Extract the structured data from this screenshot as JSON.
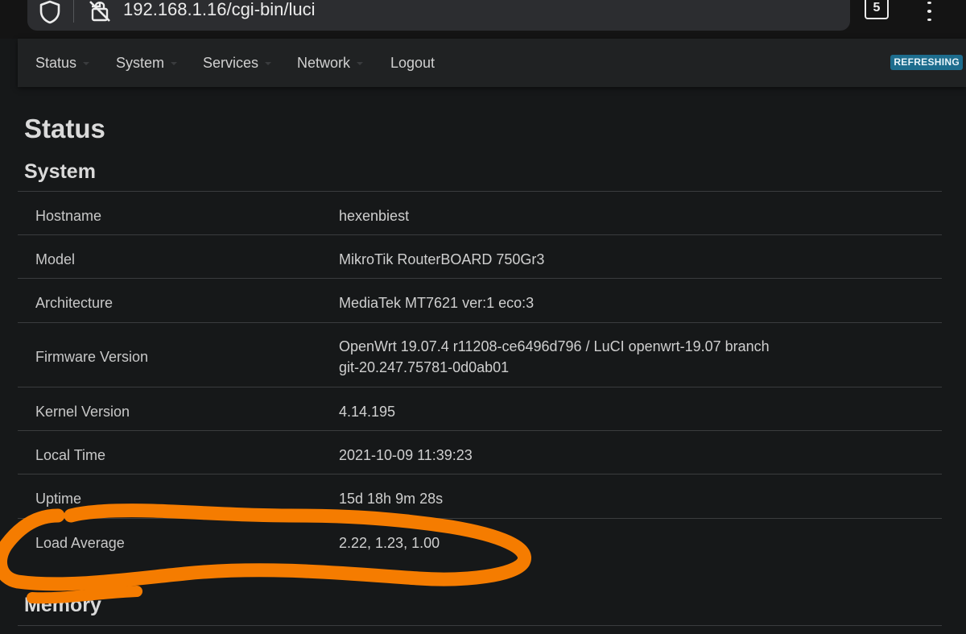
{
  "browser": {
    "url": "192.168.1.16/cgi-bin/luci",
    "tab_count": "5"
  },
  "nav": {
    "items": [
      {
        "label": "Status"
      },
      {
        "label": "System"
      },
      {
        "label": "Services"
      },
      {
        "label": "Network"
      },
      {
        "label": "Logout"
      }
    ],
    "refresh_badge": "REFRESHING"
  },
  "page": {
    "title": "Status",
    "section_title": "System",
    "next_section_title": "Memory"
  },
  "system_table": {
    "rows": [
      {
        "label": "Hostname",
        "value": "hexenbiest"
      },
      {
        "label": "Model",
        "value": "MikroTik RouterBOARD 750Gr3"
      },
      {
        "label": "Architecture",
        "value": "MediaTek MT7621 ver:1 eco:3"
      },
      {
        "label": "Firmware Version",
        "value": "OpenWrt 19.07.4 r11208-ce6496d796 / LuCI openwrt-19.07 branch",
        "value2": "git-20.247.75781-0d0ab01"
      },
      {
        "label": "Kernel Version",
        "value": "4.14.195"
      },
      {
        "label": "Local Time",
        "value": "2021-10-09 11:39:23"
      },
      {
        "label": "Uptime",
        "value": "15d 18h 9m 28s"
      },
      {
        "label": "Load Average",
        "value": "2.22, 1.23, 1.00"
      }
    ]
  },
  "colors": {
    "background": "#161819",
    "navbar": "#202223",
    "badge": "#1d6d8e",
    "annotation": "#f57c00"
  }
}
